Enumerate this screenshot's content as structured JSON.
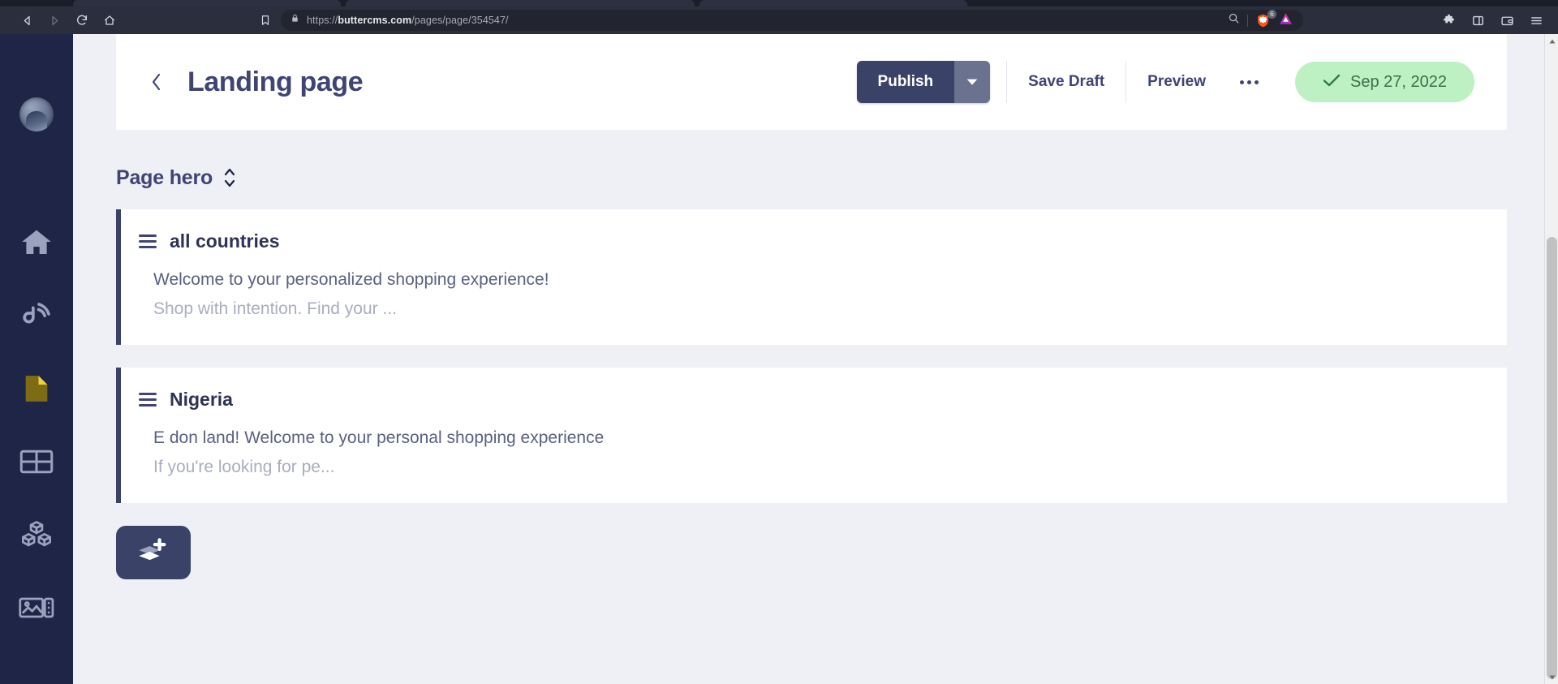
{
  "browser": {
    "name": "brave-browser",
    "nav": {
      "back_icon": "back-arrow-icon",
      "forward_icon": "forward-arrow-icon",
      "reload_icon": "reload-icon",
      "home_icon": "home-icon"
    },
    "bookmark_icon": "bookmark-icon",
    "address_bar": {
      "lock_icon": "lock-icon",
      "scheme": "https://",
      "domain": "buttercms.com",
      "path": "/pages/page/354547/",
      "full_url": "https://buttercms.com/pages/page/354547/",
      "zoom_icon": "zoom-search-icon"
    },
    "shields": {
      "icon": "brave-lion-shields-icon",
      "count": "6"
    },
    "profile_icon": "brave-triangle-profile-icon",
    "extensions_icon": "puzzle-extensions-icon",
    "sidepanel_icon": "side-panel-icon",
    "wallet_icon": "brave-wallet-icon",
    "menu_icon": "hamburger-menu-icon"
  },
  "sidebar": {
    "avatar": "user-avatar",
    "items": [
      {
        "key": "home",
        "label": "Home",
        "icon": "home-icon",
        "active": false
      },
      {
        "key": "blog",
        "label": "Blog",
        "icon": "blog-rss-icon",
        "active": false
      },
      {
        "key": "pages",
        "label": "Pages",
        "icon": "page-document-icon",
        "active": true
      },
      {
        "key": "collections",
        "label": "Collections",
        "icon": "table-grid-icon",
        "active": false
      },
      {
        "key": "components",
        "label": "Components",
        "icon": "blocks-cubes-icon",
        "active": false
      },
      {
        "key": "media",
        "label": "Media",
        "icon": "image-media-icon",
        "active": false
      }
    ]
  },
  "header": {
    "back_icon": "chevron-left-icon",
    "title": "Landing page",
    "publish_label": "Publish",
    "publish_caret_icon": "chevron-down-icon",
    "save_draft_label": "Save Draft",
    "preview_label": "Preview",
    "more_icon": "ellipsis-horizontal-icon",
    "status": {
      "check_icon": "check-icon",
      "date": "Sep 27, 2022"
    }
  },
  "main": {
    "section_label": "Page hero",
    "sort_icon": "sort-updown-icon",
    "cards": [
      {
        "drag_icon": "drag-handle-icon",
        "title": "all countries",
        "line1": "Welcome to your personalized shopping experience!",
        "line2": "Shop with intention. Find your ..."
      },
      {
        "drag_icon": "drag-handle-icon",
        "title": "Nigeria",
        "line1": "E don land! Welcome to your personal shopping experience",
        "line2": "If you're looking for pe..."
      }
    ],
    "add_button": {
      "icon": "add-layers-icon",
      "label": "Add component"
    }
  },
  "colors": {
    "sidebar_bg": "#1e2547",
    "accent_navy": "#3a4268",
    "title_navy": "#3f4472",
    "page_bg": "#eef0f6",
    "badge_green_bg": "#bdf0c3",
    "badge_green_text": "#3f6e49",
    "pages_icon_yellow": "#f2cf3f"
  }
}
